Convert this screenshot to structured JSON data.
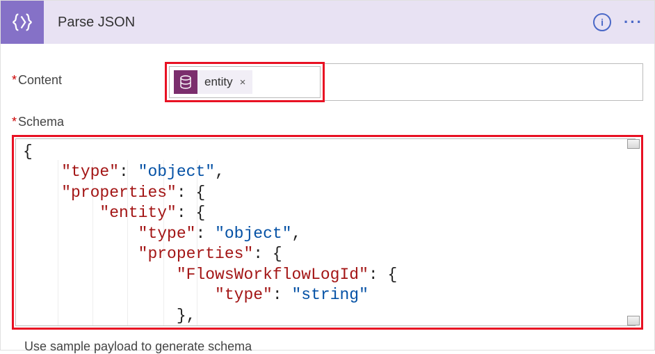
{
  "header": {
    "title": "Parse JSON"
  },
  "content": {
    "label": "Content",
    "token_label": "entity",
    "token_close": "×"
  },
  "schema": {
    "label": "Schema",
    "json_lines": [
      {
        "indent": 0,
        "segments": [
          {
            "t": "{",
            "c": "pun"
          }
        ]
      },
      {
        "indent": 1,
        "segments": [
          {
            "t": "\"type\"",
            "c": "key"
          },
          {
            "t": ": ",
            "c": "pun"
          },
          {
            "t": "\"object\"",
            "c": "str"
          },
          {
            "t": ",",
            "c": "pun"
          }
        ]
      },
      {
        "indent": 1,
        "segments": [
          {
            "t": "\"properties\"",
            "c": "key"
          },
          {
            "t": ": {",
            "c": "pun"
          }
        ]
      },
      {
        "indent": 2,
        "segments": [
          {
            "t": "\"entity\"",
            "c": "key"
          },
          {
            "t": ": {",
            "c": "pun"
          }
        ]
      },
      {
        "indent": 3,
        "segments": [
          {
            "t": "\"type\"",
            "c": "key"
          },
          {
            "t": ": ",
            "c": "pun"
          },
          {
            "t": "\"object\"",
            "c": "str"
          },
          {
            "t": ",",
            "c": "pun"
          }
        ]
      },
      {
        "indent": 3,
        "segments": [
          {
            "t": "\"properties\"",
            "c": "key"
          },
          {
            "t": ": {",
            "c": "pun"
          }
        ]
      },
      {
        "indent": 4,
        "segments": [
          {
            "t": "\"FlowsWorkflowLogId\"",
            "c": "key"
          },
          {
            "t": ": {",
            "c": "pun"
          }
        ]
      },
      {
        "indent": 5,
        "segments": [
          {
            "t": "\"type\"",
            "c": "key"
          },
          {
            "t": ": ",
            "c": "pun"
          },
          {
            "t": "\"string\"",
            "c": "str"
          }
        ]
      },
      {
        "indent": 4,
        "segments": [
          {
            "t": "},",
            "c": "pun"
          }
        ]
      }
    ]
  },
  "footer": {
    "generate_link": "Use sample payload to generate schema"
  }
}
